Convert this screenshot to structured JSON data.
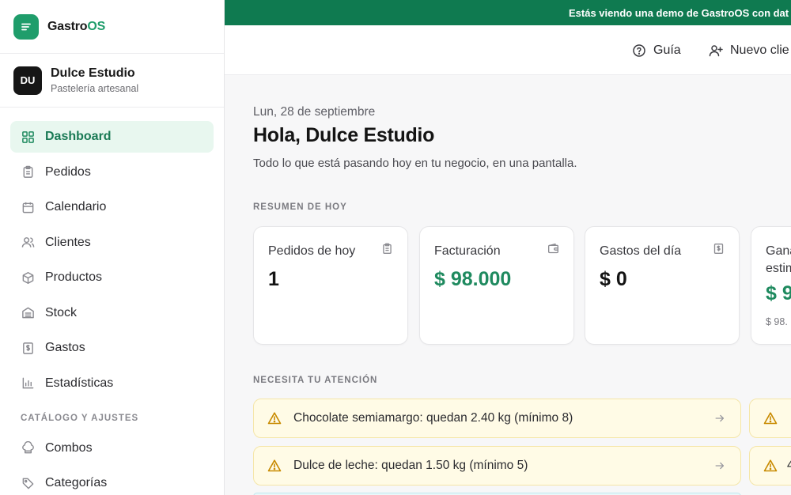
{
  "brand": {
    "name_main": "Gastro",
    "name_accent": "OS",
    "accent_color": "#1f9d6b",
    "logo_icon": "menu-lines-icon"
  },
  "workspace": {
    "initials": "DU",
    "name": "Dulce Estudio",
    "subtitle": "Pastelería artesanal"
  },
  "sidebar": {
    "items": [
      {
        "label": "Dashboard",
        "icon": "grid-icon",
        "active": true
      },
      {
        "label": "Pedidos",
        "icon": "clipboard-icon"
      },
      {
        "label": "Calendario",
        "icon": "calendar-icon"
      },
      {
        "label": "Clientes",
        "icon": "users-icon"
      },
      {
        "label": "Productos",
        "icon": "box-icon"
      },
      {
        "label": "Stock",
        "icon": "warehouse-icon"
      },
      {
        "label": "Gastos",
        "icon": "receipt-dollar-icon"
      },
      {
        "label": "Estadísticas",
        "icon": "bar-chart-icon"
      }
    ],
    "section_catalog": "CATÁLOGO Y AJUSTES",
    "catalog_items": [
      {
        "label": "Combos",
        "icon": "chef-hat-icon"
      },
      {
        "label": "Categorías",
        "icon": "tag-icon"
      }
    ]
  },
  "banner": {
    "text": "Estás viendo una demo de GastroOS con dat"
  },
  "topbar": {
    "guide_label": "Guía",
    "new_client_label": "Nuevo clie"
  },
  "main": {
    "date": "Lun, 28 de septiembre",
    "greeting": "Hola, Dulce Estudio",
    "subtitle": "Todo lo que está pasando hoy en tu negocio, en una pantalla.",
    "summary_title": "RESUMEN DE HOY",
    "cards": [
      {
        "label": "Pedidos de hoy",
        "value": "1",
        "icon": "clipboard-icon"
      },
      {
        "label": "Facturación",
        "value": "$ 98.000",
        "icon": "wallet-icon",
        "accent": true
      },
      {
        "label": "Gastos del día",
        "value": "$ 0",
        "icon": "receipt-dollar-icon"
      },
      {
        "label_line1": "Gana",
        "label_line2": "estim",
        "value": "$ 9",
        "sub": "$ 98.",
        "accent": true
      }
    ],
    "attention_title": "NECESITA TU ATENCIÓN",
    "alerts": [
      {
        "text": "Chocolate semiamargo: quedan 2.40 kg (mínimo 8)"
      },
      {
        "text": "Dulce de leche: quedan 1.50 kg (mínimo 5)"
      }
    ],
    "alerts_right": [
      {
        "text": ""
      },
      {
        "text": "4"
      }
    ]
  }
}
